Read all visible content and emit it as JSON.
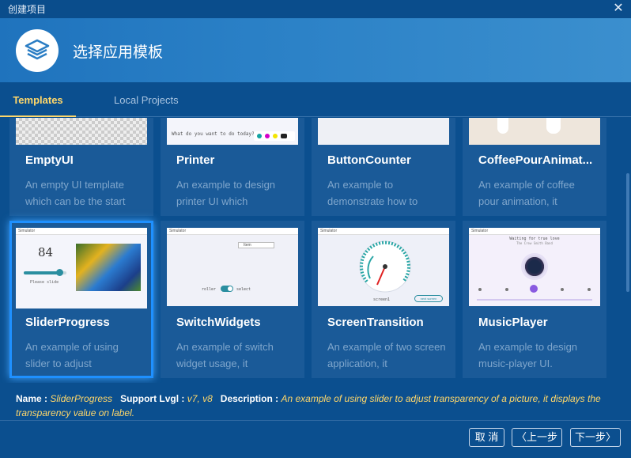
{
  "window": {
    "title": "创建项目",
    "close_glyph": "✕"
  },
  "header": {
    "title": "选择应用模板"
  },
  "tabs": [
    {
      "label": "Templates",
      "active": true
    },
    {
      "label": "Local Projects",
      "active": false
    }
  ],
  "cards": [
    {
      "name": "EmptyUI",
      "desc": "An empty UI template which can be the start"
    },
    {
      "name": "Printer",
      "desc": "An example to design printer UI which",
      "thumb_text": "What do you want to do today?"
    },
    {
      "name": "ButtonCounter",
      "desc": "An example to demonstrate how to"
    },
    {
      "name": "CoffeePourAnimat...",
      "desc": "An example of coffee pour animation, it"
    },
    {
      "name": "SliderProgress",
      "desc": "An example of using slider to adjust",
      "thumb_value": "84",
      "thumb_label": "Please slide",
      "thumb_window": "Simulator"
    },
    {
      "name": "SwitchWidgets",
      "desc": "An example of switch widget usage, it",
      "thumb_window": "Simulator",
      "thumb_left": "roller",
      "thumb_right": "select",
      "thumb_dropdown": "Item"
    },
    {
      "name": "ScreenTransition",
      "desc": "An example of two screen application, it",
      "thumb_window": "Simulator",
      "thumb_caption": "screen1",
      "thumb_button": "next screen"
    },
    {
      "name": "MusicPlayer",
      "desc": "An example to design music-player UI.",
      "thumb_window": "Simulator",
      "thumb_song": "Waiting for true love",
      "thumb_artist": "The Crew Smith Band"
    }
  ],
  "info": {
    "name_key": "Name :",
    "name_val": "SliderProgress",
    "lvgl_key": "Support Lvgl :",
    "lvgl_val": "v7, v8",
    "desc_key": "Description :",
    "desc_val": "An example of using slider to adjust transparency of a picture, it displays the transparency value on label."
  },
  "buttons": {
    "cancel": "取 消",
    "prev": "〈上一步",
    "next": "下一步〉"
  },
  "colors": {
    "accent": "#ffd76a",
    "background": "#0b4f8f",
    "selection": "#1e90ff"
  },
  "icons": {
    "logo": "layers-icon",
    "close": "close-icon"
  }
}
